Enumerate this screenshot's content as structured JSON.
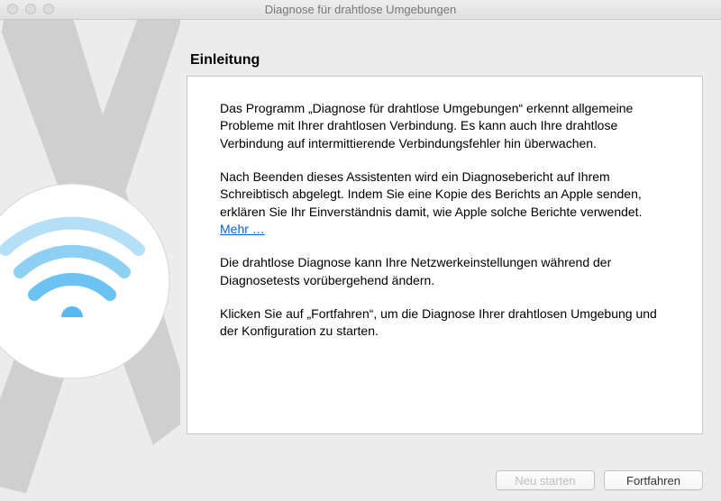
{
  "window": {
    "title": "Diagnose für drahtlose Umgebungen"
  },
  "heading": "Einleitung",
  "paragraphs": {
    "p1": "Das Programm „Diagnose für drahtlose Umgebungen“ erkennt allgemeine Probleme mit Ihrer drahtlosen Verbindung. Es kann auch Ihre drahtlose Verbindung auf intermittierende Verbindungsfehler hin überwachen.",
    "p2": "Nach Beenden dieses Assistenten wird ein Diagnosebericht auf Ihrem Schreibtisch abgelegt. Indem Sie eine Kopie des Berichts an Apple senden, erklären Sie Ihr Einverständnis damit, wie Apple solche Berichte verwendet. ",
    "more_link": "Mehr …",
    "p3": "Die drahtlose Diagnose kann Ihre Netzwerkeinstellungen während der Diagnosetests vorübergehend ändern.",
    "p4": "Klicken Sie auf „Fortfahren“, um die Diagnose Ihrer drahtlosen Umgebung und der Konfiguration zu starten."
  },
  "buttons": {
    "restart_label": "Neu starten",
    "continue_label": "Fortfahren"
  }
}
